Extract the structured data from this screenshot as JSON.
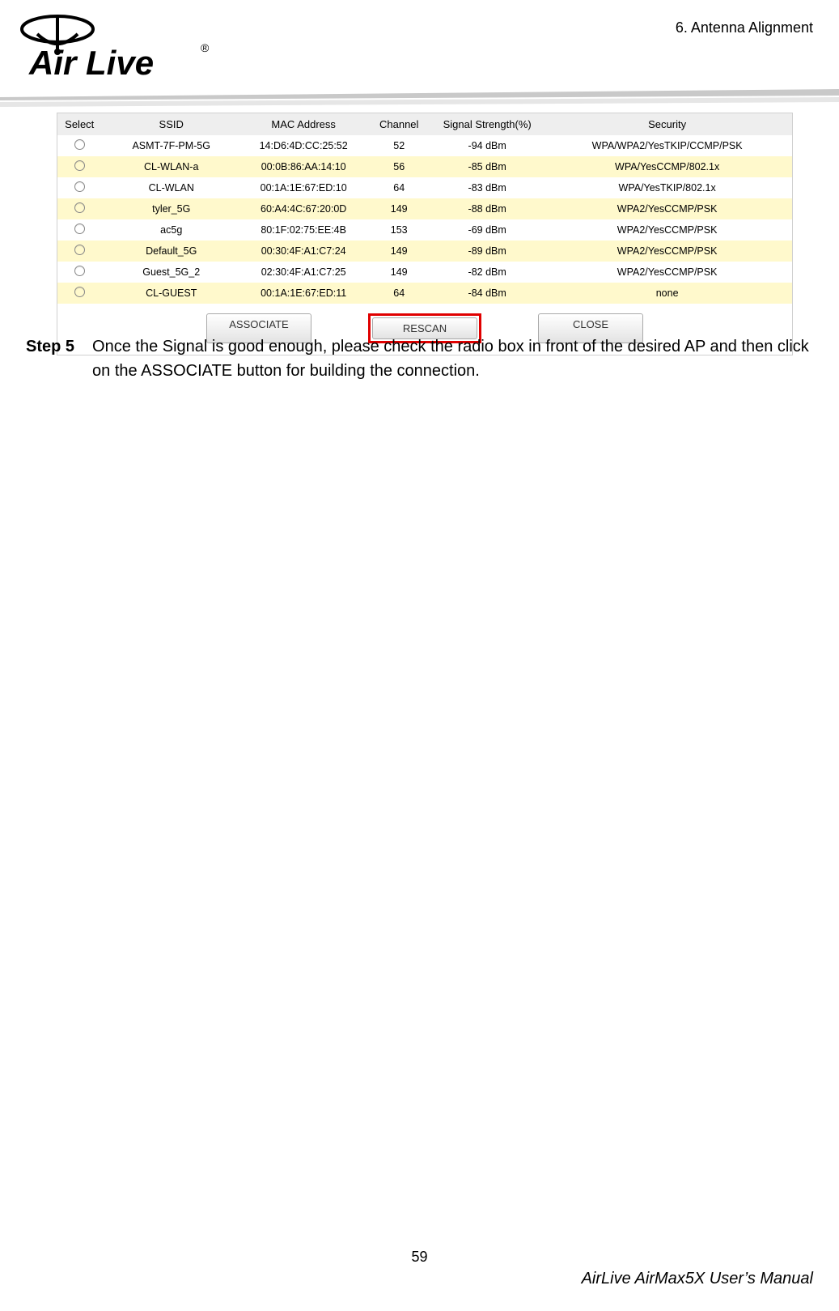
{
  "header": {
    "chapter": "6.  Antenna  Alignment",
    "brand_name": "Air Live",
    "trademark": "®"
  },
  "scan_table": {
    "headers": {
      "select": "Select",
      "ssid": "SSID",
      "mac": "MAC Address",
      "channel": "Channel",
      "signal": "Signal Strength(%)",
      "security": "Security"
    },
    "rows": [
      {
        "ssid": "ASMT-7F-PM-5G",
        "mac": "14:D6:4D:CC:25:52",
        "channel": "52",
        "signal": "-94 dBm",
        "security": "WPA/WPA2/YesTKIP/CCMP/PSK"
      },
      {
        "ssid": "CL-WLAN-a",
        "mac": "00:0B:86:AA:14:10",
        "channel": "56",
        "signal": "-85 dBm",
        "security": "WPA/YesCCMP/802.1x"
      },
      {
        "ssid": "CL-WLAN",
        "mac": "00:1A:1E:67:ED:10",
        "channel": "64",
        "signal": "-83 dBm",
        "security": "WPA/YesTKIP/802.1x"
      },
      {
        "ssid": "tyler_5G",
        "mac": "60:A4:4C:67:20:0D",
        "channel": "149",
        "signal": "-88 dBm",
        "security": "WPA2/YesCCMP/PSK"
      },
      {
        "ssid": "ac5g",
        "mac": "80:1F:02:75:EE:4B",
        "channel": "153",
        "signal": "-69 dBm",
        "security": "WPA2/YesCCMP/PSK"
      },
      {
        "ssid": "Default_5G",
        "mac": "00:30:4F:A1:C7:24",
        "channel": "149",
        "signal": "-89 dBm",
        "security": "WPA2/YesCCMP/PSK"
      },
      {
        "ssid": "Guest_5G_2",
        "mac": "02:30:4F:A1:C7:25",
        "channel": "149",
        "signal": "-82 dBm",
        "security": "WPA2/YesCCMP/PSK"
      },
      {
        "ssid": "CL-GUEST",
        "mac": "00:1A:1E:67:ED:11",
        "channel": "64",
        "signal": "-84 dBm",
        "security": "none"
      }
    ]
  },
  "buttons": {
    "associate": "ASSOCIATE",
    "rescan": "RESCAN",
    "close": "CLOSE"
  },
  "step": {
    "label": "Step 5",
    "text": "Once the Signal is good enough, please check the radio box in front of the desired AP and then click on the ASSOCIATE button for building the connection."
  },
  "footer": {
    "page_number": "59",
    "manual": "AirLive  AirMax5X  User’s  Manual"
  }
}
